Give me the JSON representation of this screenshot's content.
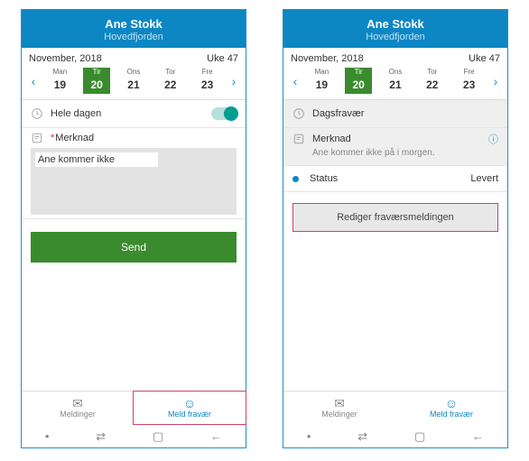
{
  "left": {
    "header": {
      "name": "Ane Stokk",
      "location": "Hovedfjorden"
    },
    "month": "November, 2018",
    "week": "Uke 47",
    "days": [
      {
        "dn": "Man",
        "dv": "19"
      },
      {
        "dn": "Tir",
        "dv": "20",
        "sel": true
      },
      {
        "dn": "Ons",
        "dv": "21"
      },
      {
        "dn": "Tor",
        "dv": "22"
      },
      {
        "dn": "Fre",
        "dv": "23"
      }
    ],
    "allDay": "Hele dagen",
    "noteLabel": "Merknad",
    "noteValue": "Ane kommer ikke",
    "send": "Send",
    "tabs": {
      "messages": "Meldinger",
      "absence": "Meld fravær"
    }
  },
  "right": {
    "header": {
      "name": "Ane Stokk",
      "location": "Hovedfjorden"
    },
    "month": "November, 2018",
    "week": "Uke 47",
    "days": [
      {
        "dn": "Man",
        "dv": "19"
      },
      {
        "dn": "Tir",
        "dv": "20",
        "sel": true
      },
      {
        "dn": "Ons",
        "dv": "21"
      },
      {
        "dn": "Tor",
        "dv": "22"
      },
      {
        "dn": "Fre",
        "dv": "23"
      }
    ],
    "dayAbsence": "Dagsfravær",
    "noteLabel": "Merknad",
    "noteText": "Ane kommer ikke på i morgen.",
    "statusLabel": "Status",
    "statusValue": "Levert",
    "edit": "Rediger fraværsmeldingen",
    "tabs": {
      "messages": "Meldinger",
      "absence": "Meld fravær"
    }
  }
}
